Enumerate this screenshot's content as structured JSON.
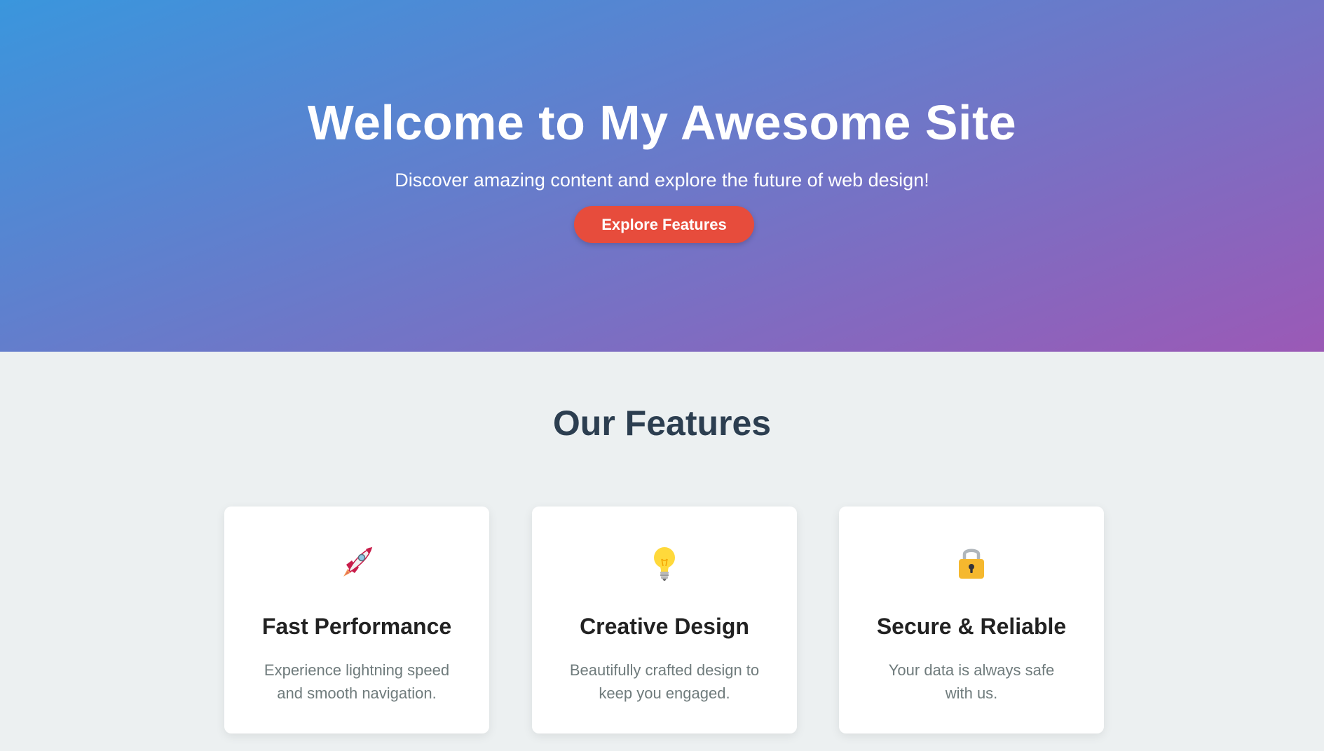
{
  "hero": {
    "title": "Welcome to My Awesome Site",
    "subtitle": "Discover amazing content and explore the future of web design!",
    "button_label": "Explore Features",
    "gradient_start": "#3a96dd",
    "gradient_end": "#9b59b6",
    "button_color": "#e74c3c"
  },
  "features": {
    "title": "Our Features",
    "cards": [
      {
        "icon": "rocket-icon",
        "title": "Fast Performance",
        "text": "Experience lightning speed and smooth navigation."
      },
      {
        "icon": "lightbulb-icon",
        "title": "Creative Design",
        "text": "Beautifully crafted design to keep you engaged."
      },
      {
        "icon": "lock-icon",
        "title": "Secure & Reliable",
        "text": "Your data is always safe with us."
      }
    ]
  }
}
